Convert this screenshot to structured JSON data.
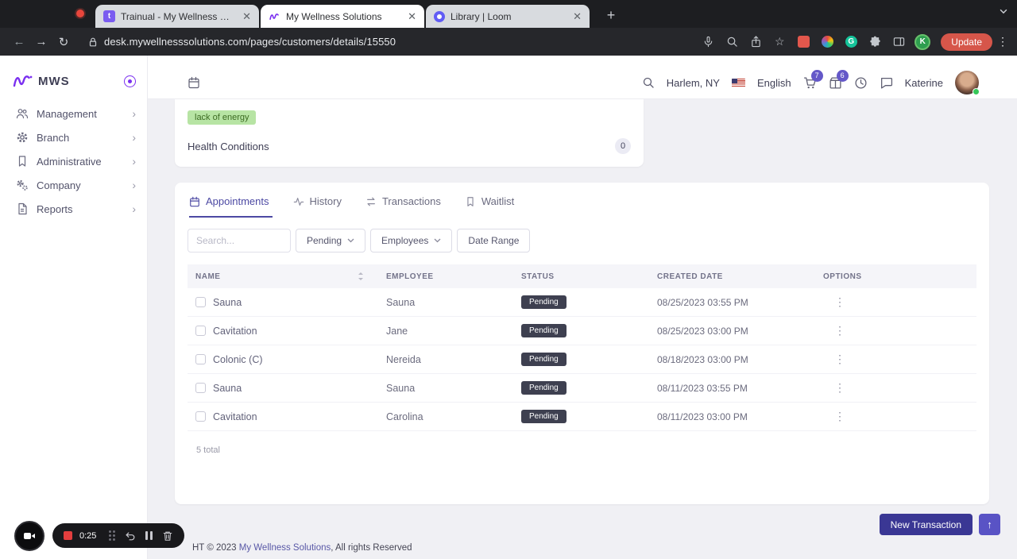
{
  "colors": {
    "accent": "#4c49a3",
    "badge": "#6458c8",
    "pending_badge": "#3e4050",
    "tag_green": "#b7e4a4",
    "primary_button": "#3a3794",
    "update_button": "#d6564a"
  },
  "browser": {
    "tabs": [
      {
        "title": "Trainual - My Wellness Solution",
        "icon": "trainual-favicon"
      },
      {
        "title": "My Wellness Solutions",
        "icon": "mws-favicon"
      },
      {
        "title": "Library | Loom",
        "icon": "loom-favicon"
      }
    ],
    "url": "desk.mywellnesssolutions.com/pages/customers/details/15550",
    "update_label": "Update",
    "profile_initial": "K"
  },
  "sidebar": {
    "logo_text": "MWS",
    "items": [
      {
        "label": "Management",
        "icon": "users-icon"
      },
      {
        "label": "Branch",
        "icon": "gear-icon"
      },
      {
        "label": "Administrative",
        "icon": "bookmark-icon"
      },
      {
        "label": "Company",
        "icon": "gears-icon"
      },
      {
        "label": "Reports",
        "icon": "reports-icon"
      }
    ]
  },
  "header": {
    "location": "Harlem, NY",
    "language": "English",
    "cart_badge": "7",
    "packages_badge": "6",
    "user_name": "Katerine"
  },
  "summary_card": {
    "tag": "lack of energy",
    "title": "Health Conditions",
    "count": "0"
  },
  "detail_tabs": [
    {
      "label": "Appointments",
      "icon": "calendar-icon"
    },
    {
      "label": "History",
      "icon": "activity-icon"
    },
    {
      "label": "Transactions",
      "icon": "exchange-icon"
    },
    {
      "label": "Waitlist",
      "icon": "bookmark-icon"
    }
  ],
  "filters": {
    "search_placeholder": "Search...",
    "status": "Pending",
    "employees": "Employees",
    "date_range": "Date Range"
  },
  "table": {
    "headers": [
      "NAME",
      "EMPLOYEE",
      "STATUS",
      "CREATED DATE",
      "OPTIONS"
    ],
    "rows": [
      {
        "name": "Sauna",
        "employee": "Sauna",
        "status": "Pending",
        "created": "08/25/2023 03:55 PM"
      },
      {
        "name": "Cavitation",
        "employee": "Jane",
        "status": "Pending",
        "created": "08/25/2023 03:00 PM"
      },
      {
        "name": "Colonic (C)",
        "employee": "Nereida",
        "status": "Pending",
        "created": "08/18/2023 03:00 PM"
      },
      {
        "name": "Sauna",
        "employee": "Sauna",
        "status": "Pending",
        "created": "08/11/2023 03:55 PM"
      },
      {
        "name": "Cavitation",
        "employee": "Carolina",
        "status": "Pending",
        "created": "08/11/2023 03:00 PM"
      }
    ],
    "total": "5 total"
  },
  "footer": {
    "prefix": "HT © 2023 ",
    "brand": "My Wellness Solutions",
    "suffix": ", All rights Reserved"
  },
  "actions": {
    "new_transaction": "New Transaction"
  },
  "loom": {
    "timer": "0:25"
  }
}
